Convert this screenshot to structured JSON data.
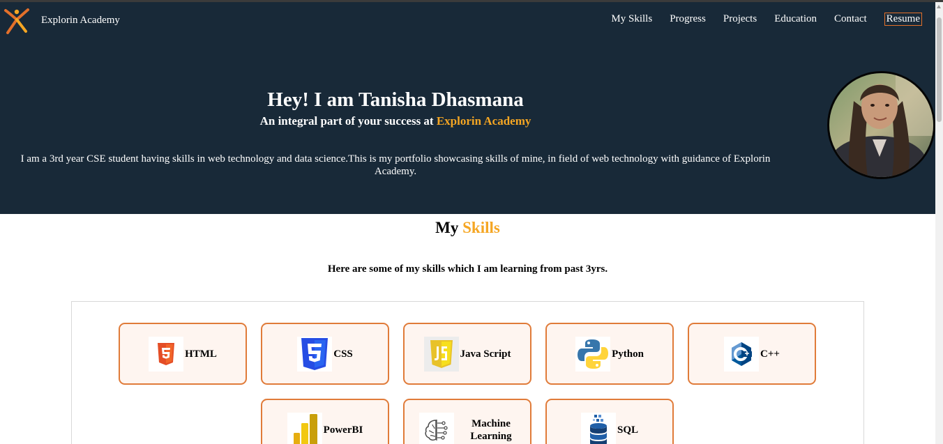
{
  "header": {
    "brand_name": "Explorin Academy",
    "nav": [
      "My Skills",
      "Progress",
      "Projects",
      "Education",
      "Contact"
    ],
    "resume_label": "Resume"
  },
  "hero": {
    "title": "Hey! I am Tanisha Dhasmana",
    "subtitle_prefix": "An integral part of your success at ",
    "subtitle_highlight": "Explorin Academy",
    "description": "I am a 3rd year CSE student having skills in web technology and data science.This is my portfolio showcasing skills of mine, in field of web technology with guidance of Explorin Academy."
  },
  "skills": {
    "title_prefix": "My ",
    "title_highlight": "Skills",
    "intro": "Here are some of my skills which I am learning from past 3yrs.",
    "items": [
      {
        "label": "HTML",
        "icon": "html5-icon"
      },
      {
        "label": "CSS",
        "icon": "css3-icon"
      },
      {
        "label": "Java Script",
        "icon": "javascript-icon"
      },
      {
        "label": "Python",
        "icon": "python-icon"
      },
      {
        "label": "C++",
        "icon": "cplusplus-icon"
      },
      {
        "label": "PowerBI",
        "icon": "powerbi-icon"
      },
      {
        "label": "Machine Learning",
        "icon": "machine-learning-icon"
      },
      {
        "label": "SQL",
        "icon": "database-icon"
      }
    ]
  },
  "colors": {
    "header_bg": "#182938",
    "accent": "#f5a623",
    "card_border": "#e07b39",
    "card_bg": "#fef5f0"
  }
}
